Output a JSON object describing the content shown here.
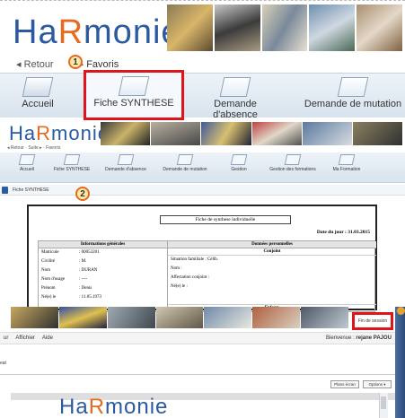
{
  "logo": {
    "part1": "Ha",
    "part2": "R",
    "part3": "monie"
  },
  "panel1": {
    "nav": {
      "back": "◂ Retour",
      "sep": "▸",
      "favorites": "Favoris"
    },
    "step": "1",
    "tabs": [
      {
        "label": "Accueil"
      },
      {
        "label": "Fiche SYNTHESE"
      },
      {
        "label": "Demande d'absence"
      },
      {
        "label": "Demande de mutation"
      }
    ]
  },
  "panel2": {
    "nav": "◂ Retour · Suite ▸ · Favoris",
    "tabs": [
      {
        "label": "Accueil"
      },
      {
        "label": "Fiche SYNTHESE"
      },
      {
        "label": "Demande d'absence"
      },
      {
        "label": "Demande de mutation"
      },
      {
        "label": "Gestion"
      },
      {
        "label": "Gestion des formations"
      },
      {
        "label": "Ma Formation"
      }
    ],
    "crumb": "Fiche SYNTHESE",
    "step": "2",
    "doc": {
      "title": "Fiche de synthese individuelle",
      "date": "Date du jour : 31.03.2015",
      "left_header": "Informations générales",
      "right_header": "Données personnelles",
      "conjoint": "Conjoint",
      "rows": [
        {
          "k": "Matricule",
          "v": ": 00053201"
        },
        {
          "k": "Civilité",
          "v": ": M."
        },
        {
          "k": "Nom",
          "v": ": DURAN"
        },
        {
          "k": "Nom d'usage",
          "v": ": ----"
        },
        {
          "k": "Prénom",
          "v": ": Denis"
        },
        {
          "k": "Né(e) le",
          "v": ": 11.05.1973"
        }
      ],
      "right_rows": [
        {
          "t": "Situation familiale : Célib."
        },
        {
          "t": "Nom :"
        },
        {
          "t": "Affectation conjoint :"
        },
        {
          "t": "Né(e) le :"
        }
      ],
      "enfants": "Enfants"
    }
  },
  "panel3": {
    "fin": "Fin de session",
    "menu": [
      "ur",
      "Affichier",
      "Aide"
    ],
    "welcome_prefix": "Bienvenue :",
    "welcome_user": "rejane PAJOU",
    "left_text": "eat",
    "btn1": "Plans écran",
    "btn2": "Options ▾"
  },
  "colors": {
    "brand_blue": "#2a5aa0",
    "brand_orange": "#e56b1f",
    "highlight_red": "#e0141b"
  }
}
